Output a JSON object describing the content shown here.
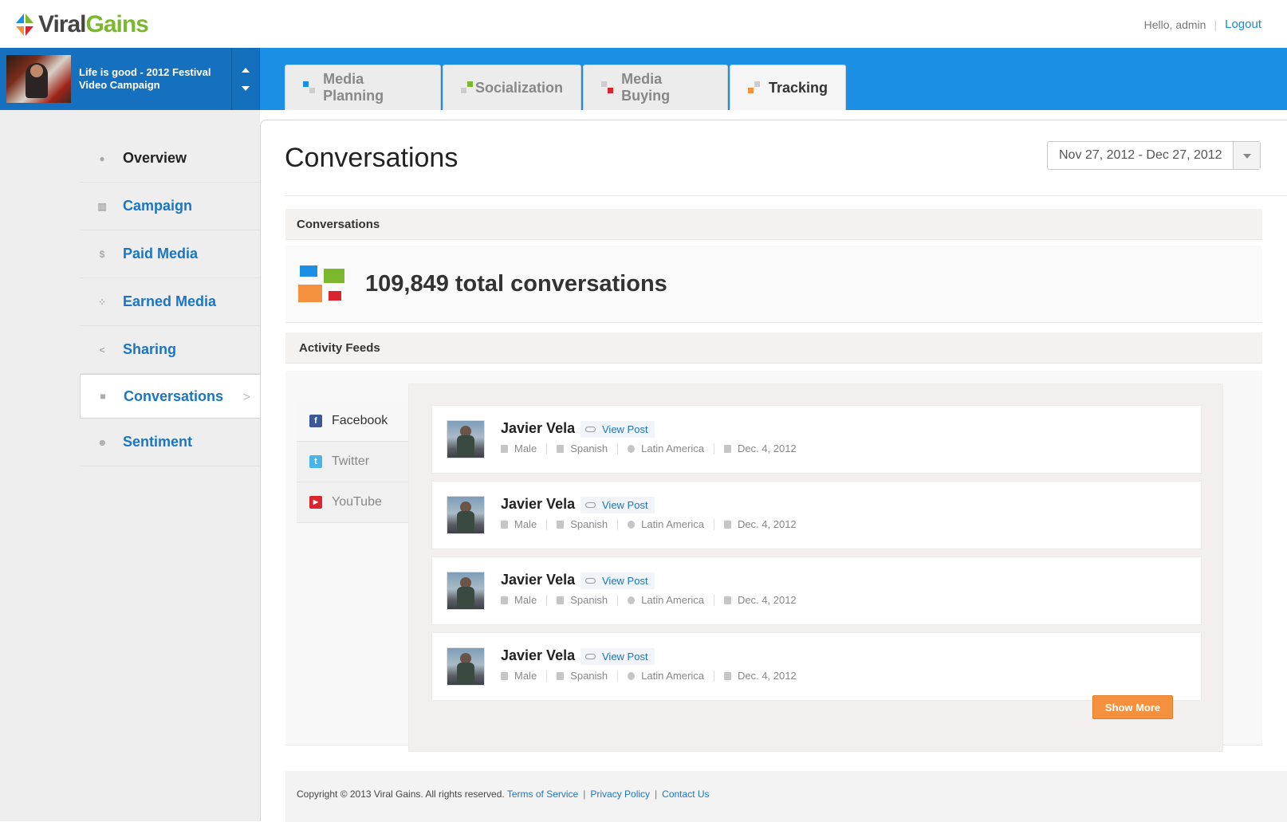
{
  "header": {
    "logo_viral": "Viral",
    "logo_gains": "Gains",
    "greeting": "Hello, admin",
    "logout": "Logout"
  },
  "campaign": {
    "title": "Life is good - 2012 Festival Video Campaign"
  },
  "tabs": [
    {
      "label": "Media Planning",
      "icon": "media-planning-icon"
    },
    {
      "label": "Socialization",
      "icon": "socialization-icon"
    },
    {
      "label": "Media Buying",
      "icon": "media-buying-icon"
    },
    {
      "label": "Tracking",
      "icon": "tracking-icon",
      "active": true
    }
  ],
  "sidebar": {
    "items": [
      {
        "label": "Overview",
        "icon": "globe-icon"
      },
      {
        "label": "Campaign",
        "icon": "bar-chart-icon"
      },
      {
        "label": "Paid Media",
        "icon": "dollar-icon"
      },
      {
        "label": "Earned Media",
        "icon": "people-icon"
      },
      {
        "label": "Sharing",
        "icon": "share-icon"
      },
      {
        "label": "Conversations",
        "icon": "speech-bubble-icon",
        "active": true
      },
      {
        "label": "Sentiment",
        "icon": "smiley-icon"
      }
    ]
  },
  "main": {
    "title": "Conversations",
    "date_range": "Nov 27, 2012 - Dec 27, 2012",
    "conversations_panel": {
      "heading": "Conversations",
      "total": "109,849 total conversations"
    },
    "activity_panel": {
      "heading": "Activity Feeds",
      "feed_tabs": [
        {
          "label": "Facebook",
          "icon": "facebook-icon",
          "active": true
        },
        {
          "label": "Twitter",
          "icon": "twitter-icon"
        },
        {
          "label": "YouTube",
          "icon": "youtube-icon"
        }
      ],
      "posts": [
        {
          "name": "Javier Vela",
          "link": "View Post",
          "gender": "Male",
          "language": "Spanish",
          "region": "Latin America",
          "date": "Dec. 4, 2012"
        },
        {
          "name": "Javier Vela",
          "link": "View Post",
          "gender": "Male",
          "language": "Spanish",
          "region": "Latin America",
          "date": "Dec. 4, 2012"
        },
        {
          "name": "Javier Vela",
          "link": "View Post",
          "gender": "Male",
          "language": "Spanish",
          "region": "Latin America",
          "date": "Dec. 4, 2012"
        },
        {
          "name": "Javier Vela",
          "link": "View Post",
          "gender": "Male",
          "language": "Spanish",
          "region": "Latin America",
          "date": "Dec. 4, 2012"
        }
      ],
      "show_more": "Show More"
    }
  },
  "footer": {
    "copyright": "Copyright © 2013 Viral Gains. All rights reserved.",
    "terms": "Terms of Service",
    "privacy": "Privacy Policy",
    "contact": "Contact Us"
  },
  "colors": {
    "brand_blue": "#1a8fe3",
    "link_blue": "#1a76c4",
    "accent_orange": "#f5913e",
    "brand_green": "#7bb82e"
  }
}
